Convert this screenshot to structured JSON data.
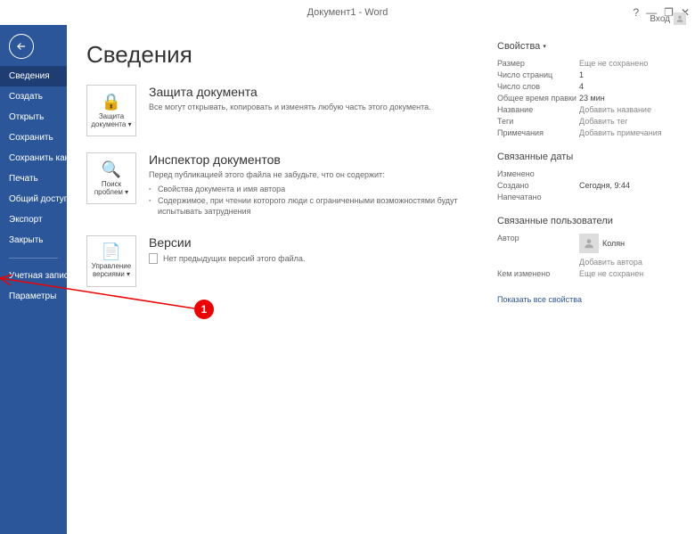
{
  "titlebar": {
    "title": "Документ1 - Word",
    "login": "Вход"
  },
  "sidebar": {
    "items": [
      "Сведения",
      "Создать",
      "Открыть",
      "Сохранить",
      "Сохранить как",
      "Печать",
      "Общий доступ",
      "Экспорт",
      "Закрыть"
    ],
    "footer": [
      "Учетная запись",
      "Параметры"
    ]
  },
  "page": {
    "title": "Сведения"
  },
  "protect": {
    "tile": "Защита документа",
    "title": "Защита документа",
    "text": "Все могут открывать, копировать и изменять любую часть этого документа."
  },
  "inspect": {
    "tile": "Поиск проблем",
    "title": "Инспектор документов",
    "lead": "Перед публикацией этого файла не забудьте, что он содержит:",
    "li1": "Свойства документа и имя автора",
    "li2": "Содержимое, при чтении которого люди с ограниченными возможностями будут испытывать затруднения"
  },
  "versions": {
    "tile": "Управление версиями",
    "title": "Версии",
    "text": "Нет предыдущих версий этого файла."
  },
  "props": {
    "title": "Свойства",
    "rows": {
      "size_l": "Размер",
      "size_v": "Еще не сохранено",
      "pages_l": "Число страниц",
      "pages_v": "1",
      "words_l": "Число слов",
      "words_v": "4",
      "edit_l": "Общее время правки",
      "edit_v": "23 мин",
      "name_l": "Название",
      "name_v": "Добавить название",
      "tags_l": "Теги",
      "tags_v": "Добавить тег",
      "notes_l": "Примечания",
      "notes_v": "Добавить примечания"
    },
    "dates": {
      "heading": "Связанные даты",
      "mod_l": "Изменено",
      "created_l": "Создано",
      "created_v": "Сегодня, 9:44",
      "printed_l": "Напечатано"
    },
    "users": {
      "heading": "Связанные пользователи",
      "author_l": "Автор",
      "author_v": "Колян",
      "add_author": "Добавить автора",
      "changed_l": "Кем изменено",
      "changed_v": "Еще не сохранен"
    },
    "show_all": "Показать все свойства"
  },
  "anno": {
    "num": "1"
  }
}
